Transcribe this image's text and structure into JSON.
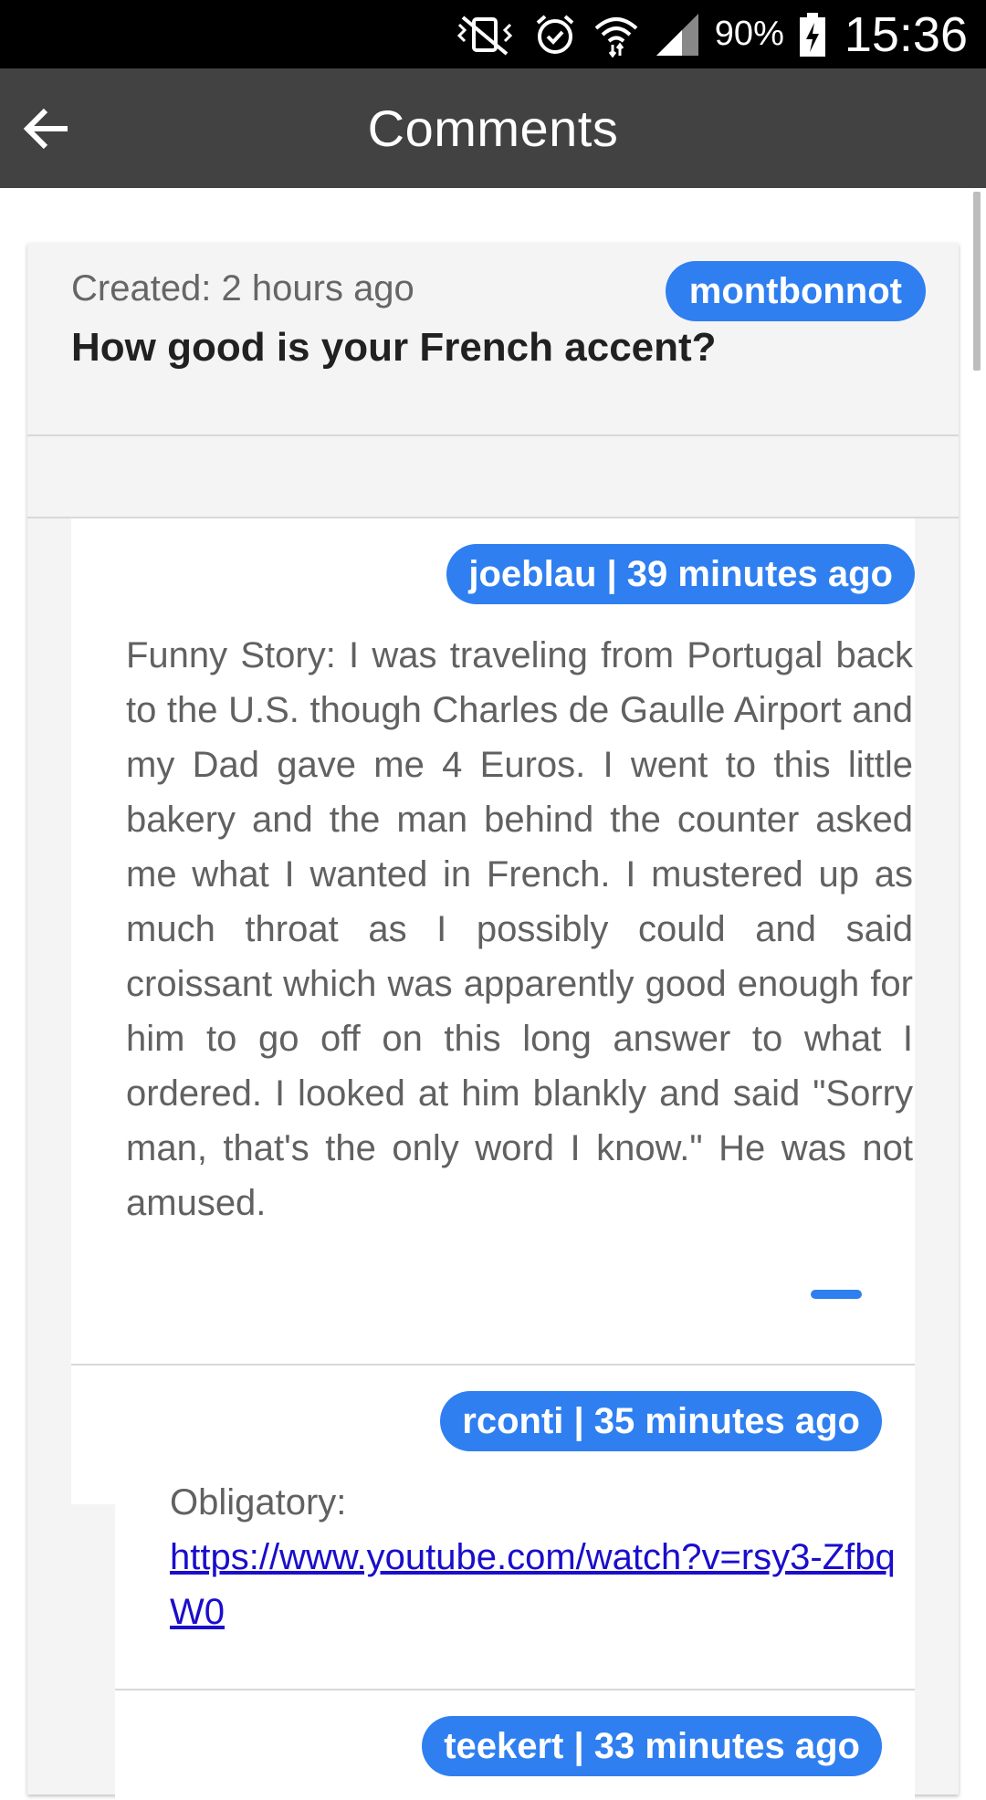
{
  "status_bar": {
    "battery": "90%",
    "time": "15:36"
  },
  "app_bar": {
    "title": "Comments"
  },
  "post": {
    "created": "Created: 2 hours ago",
    "author": "montbonnot",
    "title": "How good is your French accent?"
  },
  "comments": [
    {
      "meta": "joeblau | 39 minutes ago",
      "text": "Funny Story: I was traveling from Portugal back to the U.S. though Charles de Gaulle Airport and my Dad gave me 4 Euros. I went to this little bakery and the man behind the counter asked me what I wanted in French. I mustered up as much throat as I possibly could and said croissant which was apparently good enough for him to go off on this long answer to what I ordered. I looked at him blankly and said \"Sorry man, that's the only word I know.\" He was not amused.",
      "replies": [
        {
          "meta": "rconti | 35 minutes ago",
          "text": "Obligatory:",
          "link": "https://www.youtube.com/watch?v=rsy3-ZfbqW0"
        },
        {
          "meta": "teekert | 33 minutes ago"
        }
      ]
    }
  ]
}
